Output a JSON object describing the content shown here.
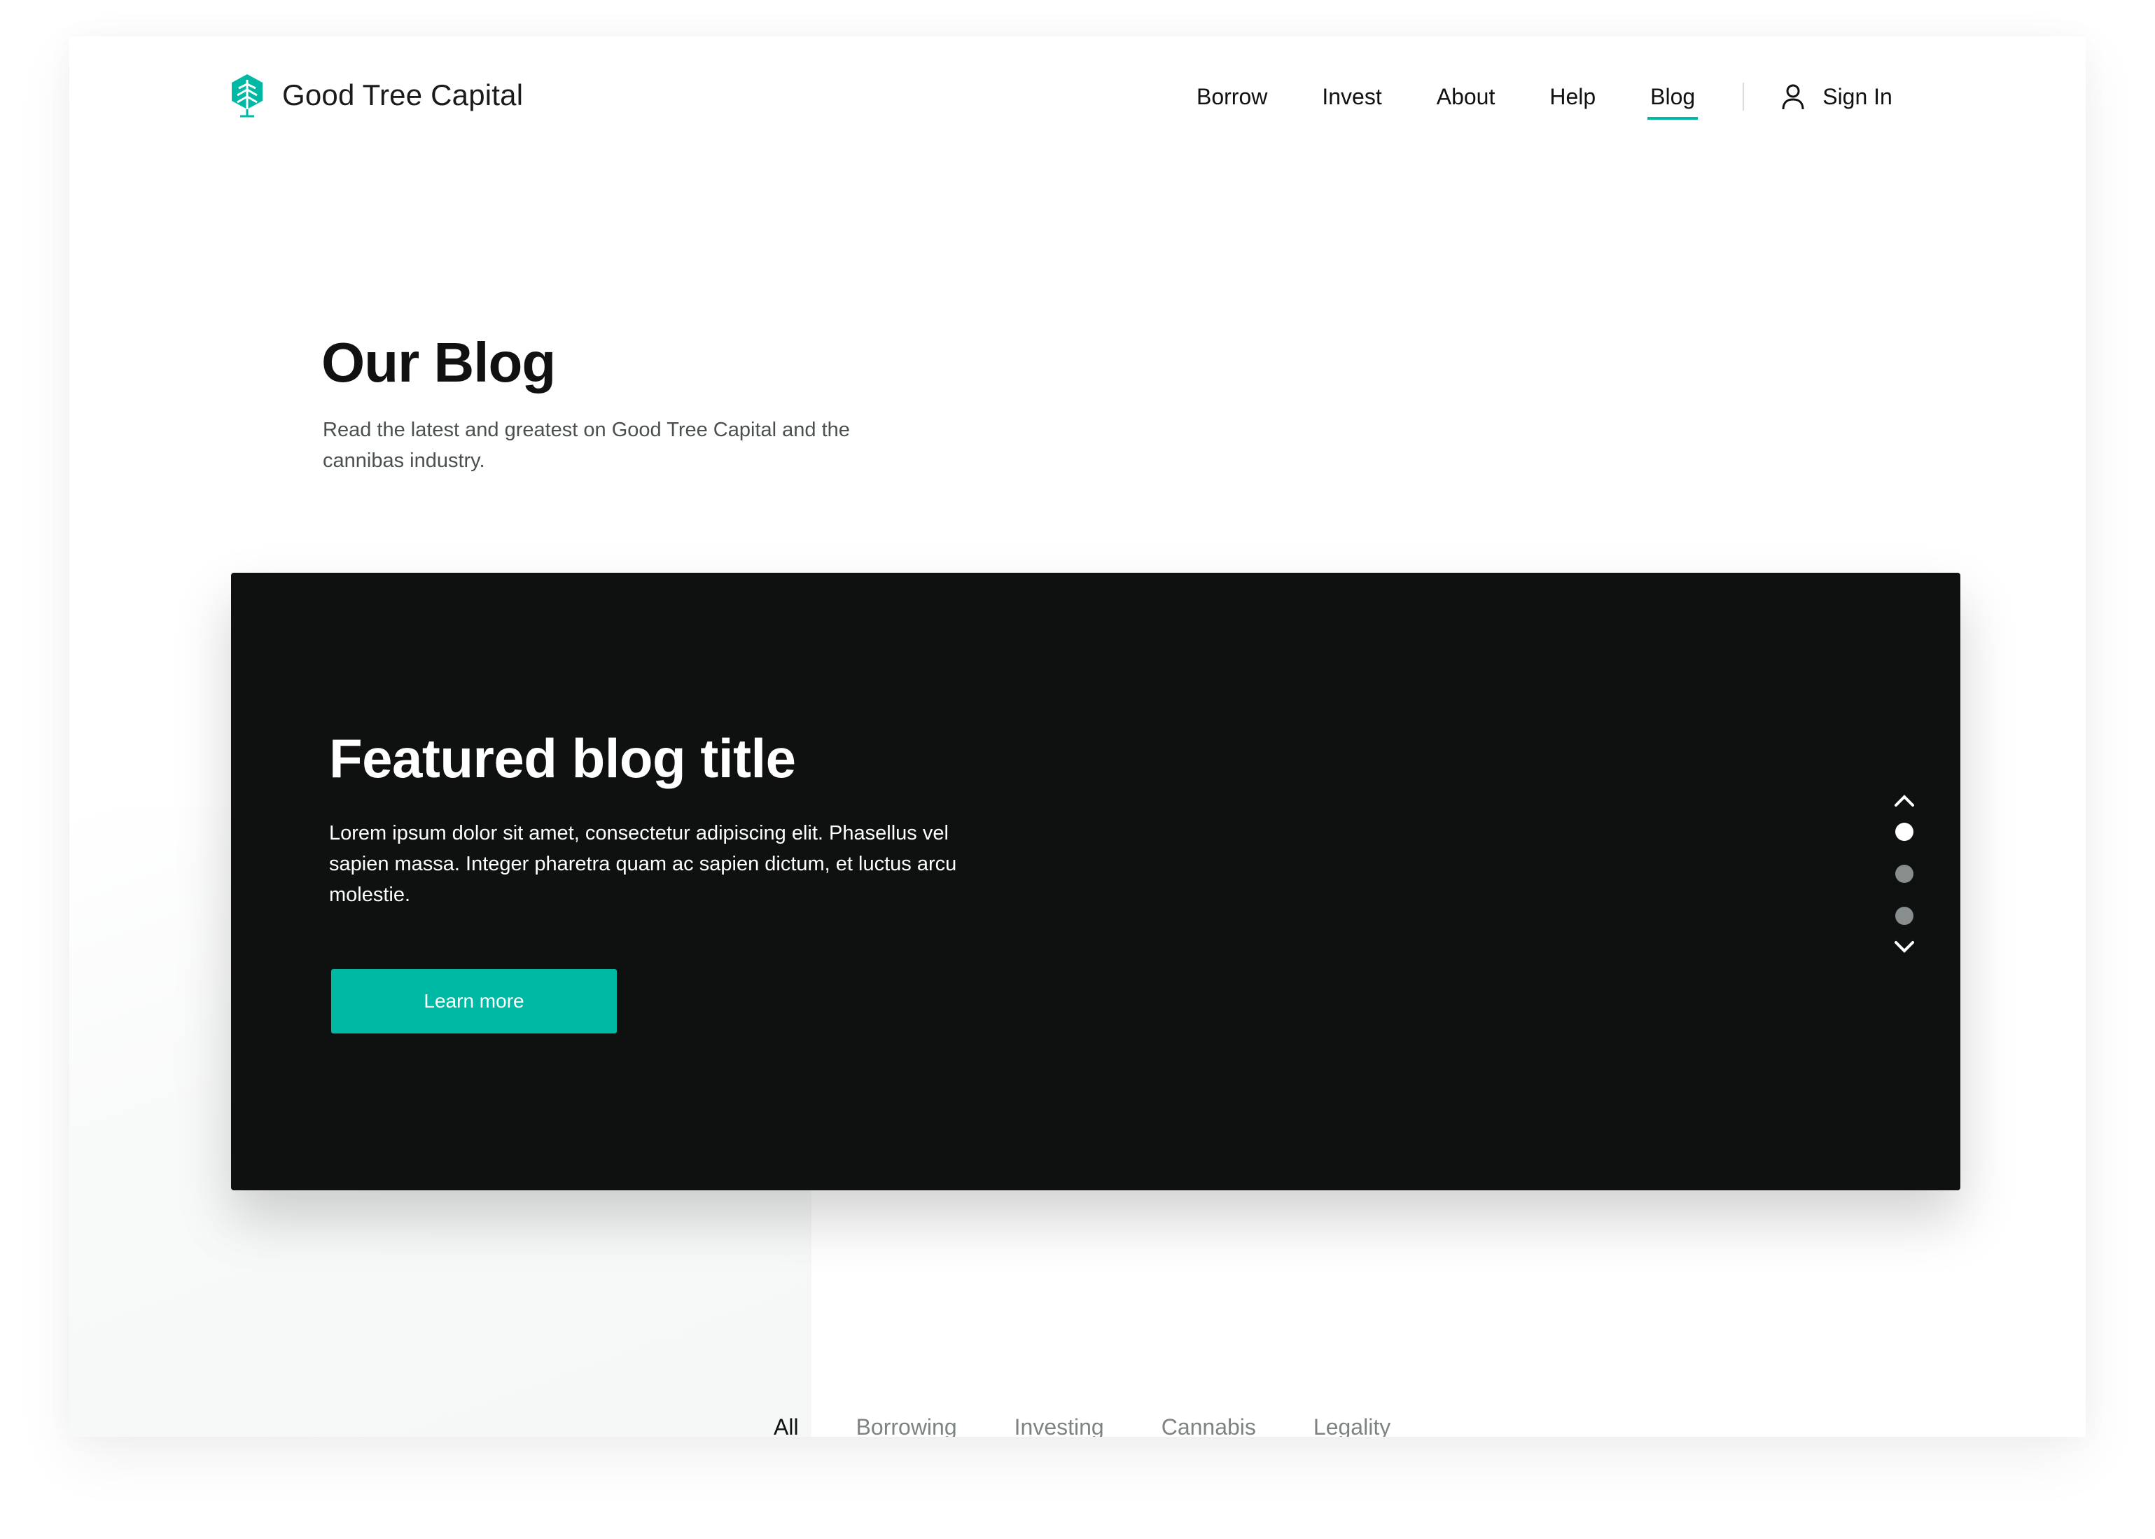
{
  "brand": {
    "name": "Good Tree Capital",
    "logo_icon": "tree-icon",
    "accent_color": "#00b9a4"
  },
  "nav": {
    "items": [
      {
        "label": "Borrow",
        "active": false
      },
      {
        "label": "Invest",
        "active": false
      },
      {
        "label": "About",
        "active": false
      },
      {
        "label": "Help",
        "active": false
      },
      {
        "label": "Blog",
        "active": true
      }
    ],
    "signin_label": "Sign In",
    "signin_icon": "user-icon"
  },
  "hero": {
    "title": "Our Blog",
    "subtitle": "Read the latest and greatest on Good Tree Capital and the cannibas industry."
  },
  "featured": {
    "title": "Featured blog title",
    "body": "Lorem ipsum dolor sit amet, consectetur adipiscing elit. Phasellus vel sapien massa. Integer pharetra quam ac sapien dictum, et luctus arcu molestie.",
    "button_label": "Learn more",
    "background_color": "#0f1111",
    "pager": {
      "up_icon": "chevron-up-icon",
      "down_icon": "chevron-down-icon",
      "dot_count": 3,
      "active_dot": 1
    }
  },
  "categories": {
    "tabs": [
      {
        "label": "All",
        "active": true
      },
      {
        "label": "Borrowing",
        "active": false
      },
      {
        "label": "Investing",
        "active": false
      },
      {
        "label": "Cannabis",
        "active": false
      },
      {
        "label": "Legality",
        "active": false
      }
    ]
  }
}
